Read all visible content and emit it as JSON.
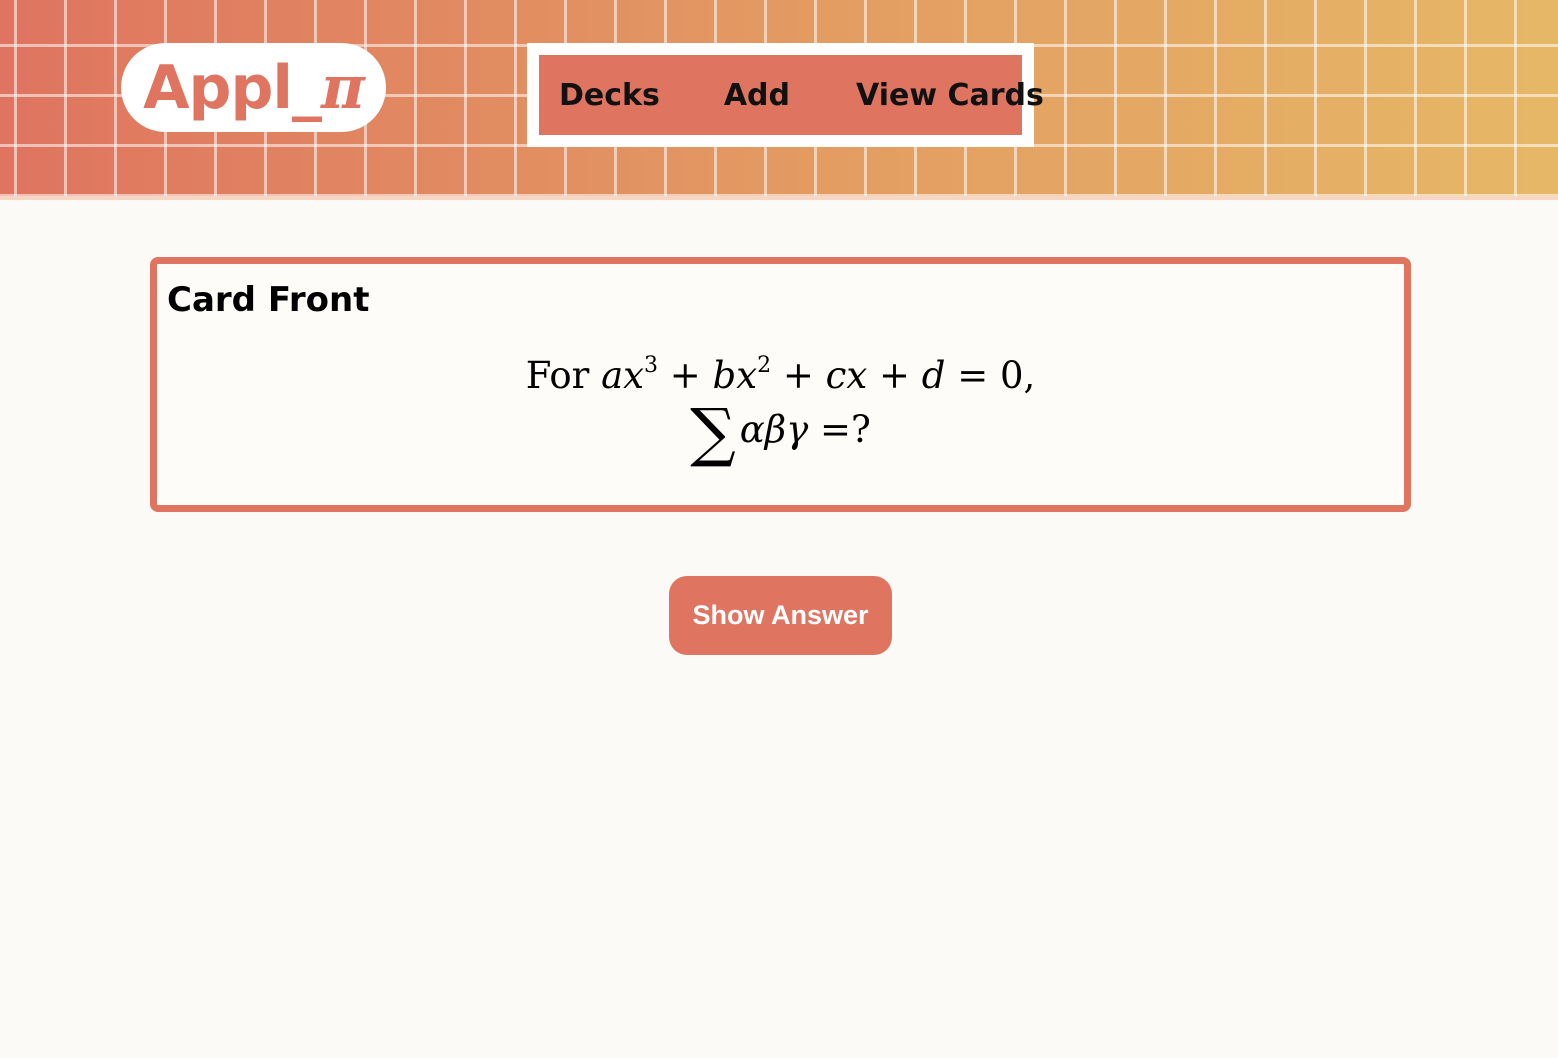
{
  "app": {
    "logo_text": "Appl_",
    "logo_symbol": "π"
  },
  "nav": {
    "items": [
      {
        "label": "Decks"
      },
      {
        "label": "Add"
      },
      {
        "label": "View Cards"
      }
    ]
  },
  "card": {
    "title": "Card Front",
    "question_line1_word": "For",
    "question_line1_math": "ax³ + bx² + cx + d = 0,",
    "question_line2_math": "∑ αβγ =?"
  },
  "actions": {
    "show_answer_label": "Show Answer"
  },
  "colors": {
    "accent": "#df7460",
    "background": "#fcfaf6",
    "header_gradient_start": "#df7460",
    "header_gradient_end": "#e6b866"
  }
}
